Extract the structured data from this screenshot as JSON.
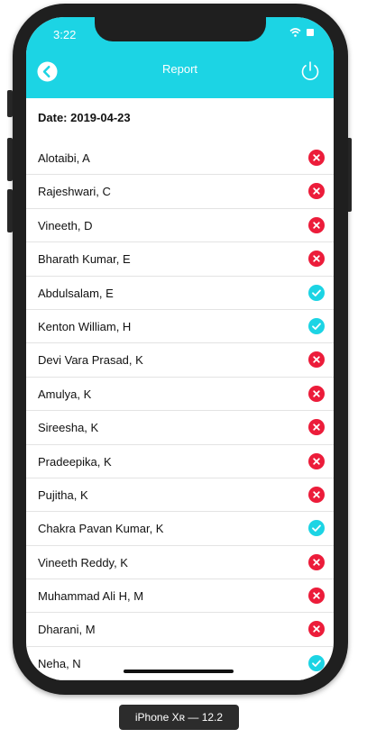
{
  "status_bar": {
    "time": "3:22"
  },
  "header": {
    "title": "Report",
    "accent_color": "#1cd4e4"
  },
  "date_label": "Date: 2019-04-23",
  "attendance": [
    {
      "name": "Alotaibi, A",
      "status": "absent"
    },
    {
      "name": "Rajeshwari, C",
      "status": "absent"
    },
    {
      "name": "Vineeth, D",
      "status": "absent"
    },
    {
      "name": "Bharath Kumar, E",
      "status": "absent"
    },
    {
      "name": "Abdulsalam, E",
      "status": "present"
    },
    {
      "name": "Kenton William, H",
      "status": "present"
    },
    {
      "name": "Devi Vara Prasad, K",
      "status": "absent"
    },
    {
      "name": "Amulya, K",
      "status": "absent"
    },
    {
      "name": "Sireesha, K",
      "status": "absent"
    },
    {
      "name": "Pradeepika, K",
      "status": "absent"
    },
    {
      "name": "Pujitha, K",
      "status": "absent"
    },
    {
      "name": "Chakra Pavan Kumar, K",
      "status": "present"
    },
    {
      "name": "Vineeth Reddy, K",
      "status": "absent"
    },
    {
      "name": "Muhammad Ali H, M",
      "status": "absent"
    },
    {
      "name": "Dharani, M",
      "status": "absent"
    },
    {
      "name": "Neha, N",
      "status": "present"
    }
  ],
  "colors": {
    "absent": "#ec1c3a",
    "present": "#1cd4e4"
  },
  "device_label": "iPhone Xʀ — 12.2"
}
